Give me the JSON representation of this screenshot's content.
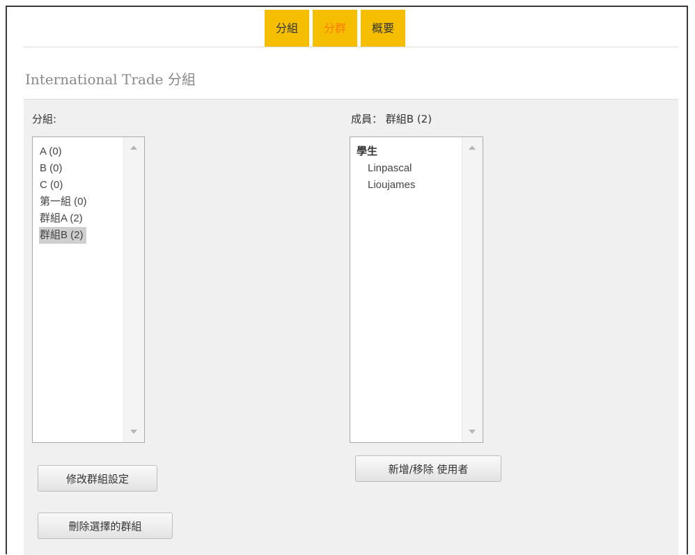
{
  "tabs": [
    {
      "label": "分組",
      "active": false
    },
    {
      "label": "分群",
      "active": true
    },
    {
      "label": "概要",
      "active": false
    }
  ],
  "page_title": "International Trade 分組",
  "groups_panel": {
    "label": "分組:",
    "options": [
      {
        "label": "A (0)",
        "selected": false
      },
      {
        "label": "B (0)",
        "selected": false
      },
      {
        "label": "C (0)",
        "selected": false
      },
      {
        "label": "第一組 (0)",
        "selected": false
      },
      {
        "label": "群組A (2)",
        "selected": false
      },
      {
        "label": "群組B (2)",
        "selected": true
      }
    ]
  },
  "members_panel": {
    "label": "成員： 群組B (2)",
    "group_heading": "學生",
    "members": [
      "Linpascal",
      "Lioujames"
    ]
  },
  "buttons": {
    "modify_group": "修改群組設定",
    "delete_group": "刪除選擇的群組",
    "add_remove_users": "新增/移除 使用者"
  },
  "colors": {
    "tab_bg": "#f5bf00",
    "active_tab_text": "#ff7a00",
    "panel_bg": "#f0f0f0",
    "selected_option_bg": "#cfcfcf"
  }
}
